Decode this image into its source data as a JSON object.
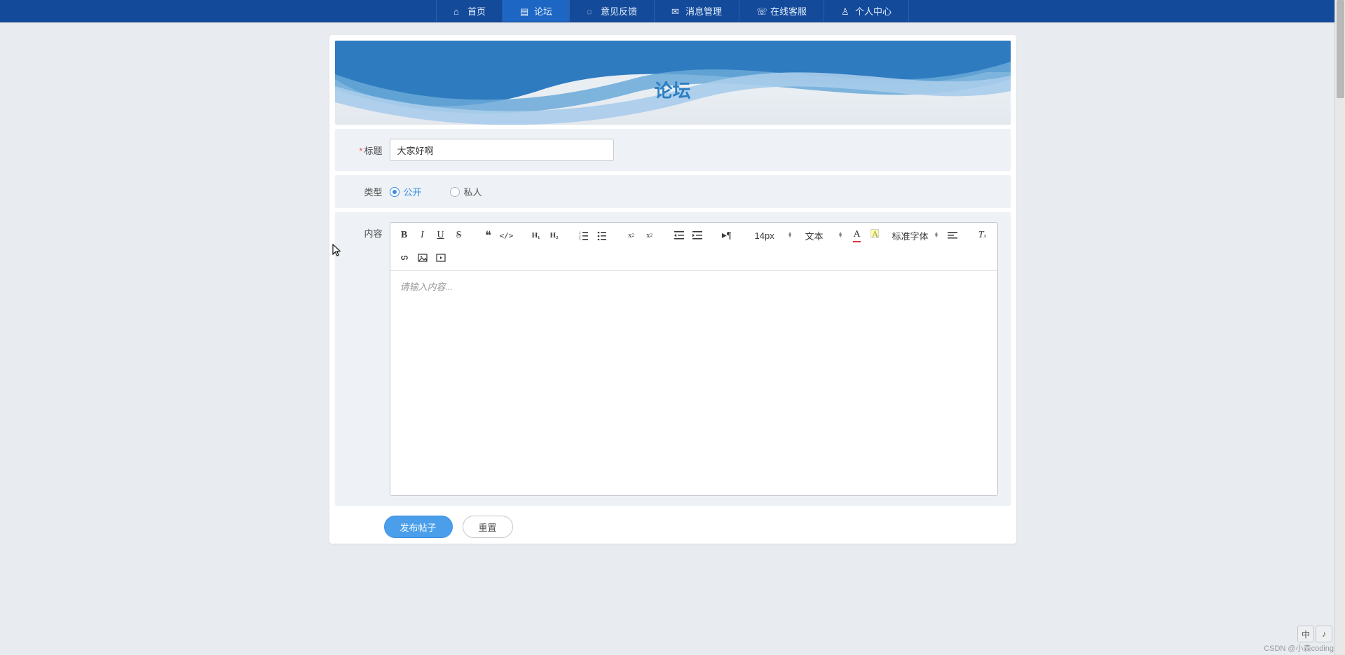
{
  "nav": {
    "items": [
      {
        "icon": "home",
        "label": "首页"
      },
      {
        "icon": "forum",
        "label": "论坛",
        "active": true
      },
      {
        "icon": "feedback",
        "label": "意见反馈"
      },
      {
        "icon": "msg",
        "label": "消息管理"
      },
      {
        "icon": "service",
        "label": "在线客服"
      },
      {
        "icon": "user",
        "label": "个人中心"
      }
    ]
  },
  "hero": {
    "title": "论坛"
  },
  "form": {
    "title": {
      "label": "标题",
      "required": "*",
      "value": "大家好啊"
    },
    "type": {
      "label": "类型",
      "options": [
        "公开",
        "私人"
      ],
      "selected": "公开"
    },
    "content": {
      "label": "内容",
      "placeholder": "请输入内容..."
    }
  },
  "toolbar": {
    "size_select": "14px",
    "block_select": "文本",
    "font_select": "标准字体"
  },
  "buttons": {
    "submit": "发布帖子",
    "reset": "重置"
  },
  "ime": {
    "lang": "中",
    "mode": "♪"
  },
  "watermark": "CSDN @小森coding"
}
